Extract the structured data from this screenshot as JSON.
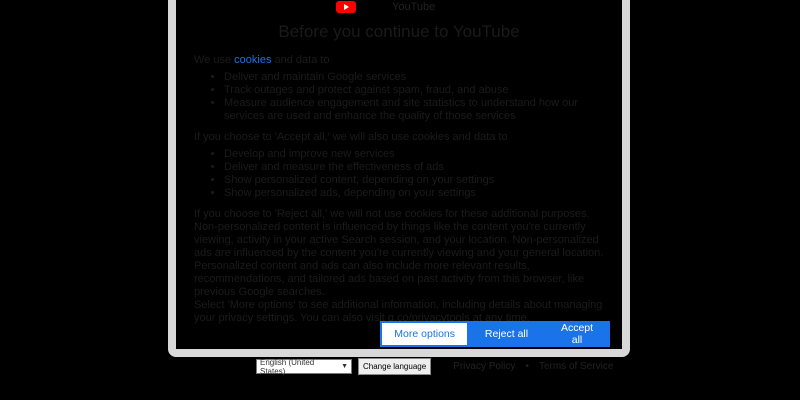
{
  "brand": {
    "text": "YouTube"
  },
  "dialog": {
    "title": "Before you continue to YouTube",
    "intro": {
      "prefix": "We use ",
      "link": "cookies",
      "suffix": " and data to"
    },
    "list1": [
      "Deliver and maintain Google services",
      "Track outages and protect against spam, fraud, and abuse",
      "Measure audience engagement and site statistics to understand how our services are used and enhance the quality of those services"
    ],
    "section2": "If you choose to 'Accept all,' we will also use cookies and data to",
    "list2": [
      "Develop and improve new services",
      "Deliver and measure the effectiveness of ads",
      "Show personalized content, depending on your settings",
      "Show personalized ads, depending on your settings"
    ],
    "section3": "If you choose to 'Reject all,' we will not use cookies for these additional purposes.",
    "paragraph1": "Non-personalized content is influenced by things like the content you're currently viewing, activity in your active Search session, and your location. Non-personalized ads are influenced by the content you're currently viewing and your general location. Personalized content and ads can also include more relevant results, recommendations, and tailored ads based on past activity from this browser, like previous Google searches.",
    "paragraph2": "Select 'More options' to see additional information, including details about managing your privacy settings. You can also visit g.co/privacytools at any time.",
    "buttons": {
      "more": "More options",
      "reject": "Reject all",
      "accept": "Accept all"
    }
  },
  "footer": {
    "language_value": "English (United States)",
    "change_language": "Change language",
    "privacy": "Privacy Policy",
    "terms": "Terms of Service"
  }
}
